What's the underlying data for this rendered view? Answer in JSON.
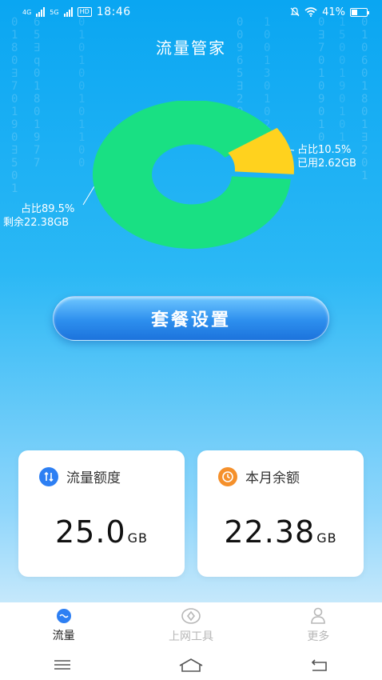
{
  "status": {
    "network1": "4G",
    "network2": "5G",
    "hd": "HD",
    "time": "18:46",
    "battery": "41%"
  },
  "title": "流量管家",
  "chart_data": {
    "type": "pie",
    "categories": [
      "已用",
      "剩余"
    ],
    "values": [
      2.62,
      22.38
    ],
    "unit": "GB",
    "colors": [
      "#ffd21e",
      "#19e083"
    ],
    "labels": {
      "used_percent": "占比10.5%",
      "used_amount": "已用2.62GB",
      "remain_percent": "占比89.5%",
      "remain_amount": "剩余22.38GB"
    }
  },
  "plan_button": "套餐设置",
  "cards": {
    "quota": {
      "label": "流量额度",
      "value": "25.0",
      "unit": "GB",
      "icon_color": "#2d7ff3"
    },
    "remaining": {
      "label": "本月余额",
      "value": "22.38",
      "unit": "GB",
      "icon_color": "#f5902b"
    }
  },
  "tabs": [
    {
      "label": "流量",
      "active": true
    },
    {
      "label": "上网工具",
      "active": false
    },
    {
      "label": "更多",
      "active": false
    }
  ]
}
